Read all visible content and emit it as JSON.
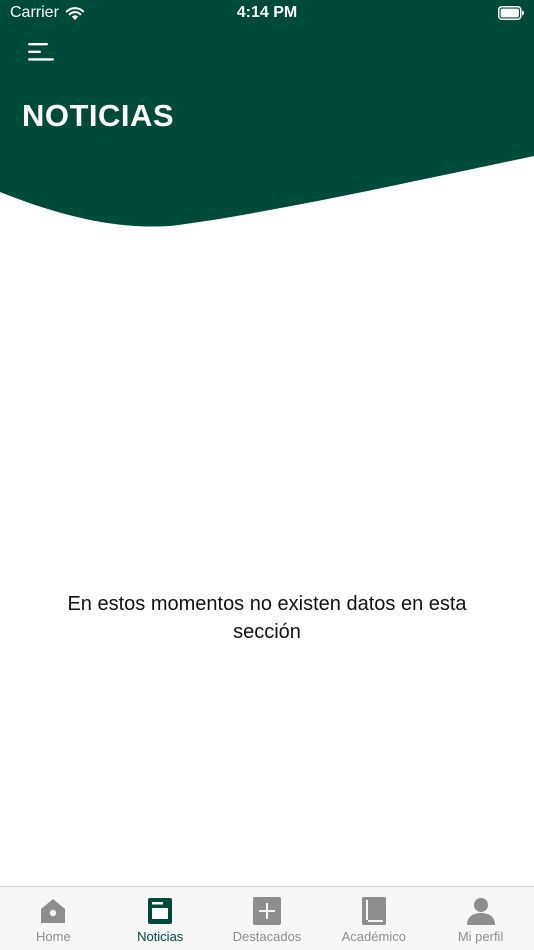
{
  "colors": {
    "header": "#004a39",
    "tab_active": "#004a39",
    "tab_inactive": "#8e8e8e"
  },
  "status_bar": {
    "carrier": "Carrier",
    "time": "4:14 PM"
  },
  "header": {
    "title": "NOTICIAS",
    "menu_icon": "hamburger-menu-icon"
  },
  "main": {
    "empty_message": "En estos momentos no existen datos en esta sección"
  },
  "tab_bar": {
    "active": "Noticias",
    "tabs": [
      {
        "label": "Home",
        "icon": "home-icon"
      },
      {
        "label": "Noticias",
        "icon": "news-icon"
      },
      {
        "label": "Destacados",
        "icon": "plus-box-icon"
      },
      {
        "label": "Académico",
        "icon": "book-icon"
      },
      {
        "label": "Mi perfil",
        "icon": "person-icon"
      }
    ]
  }
}
